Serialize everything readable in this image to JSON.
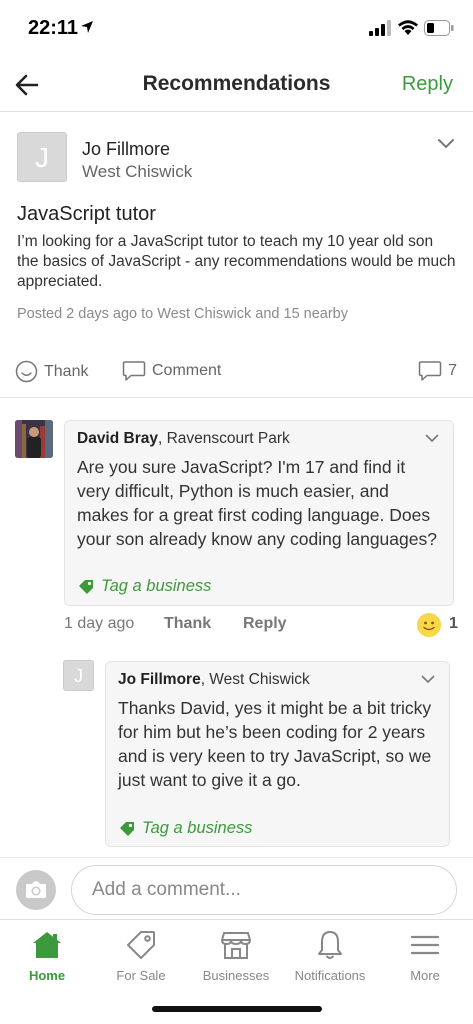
{
  "status": {
    "time": "22:11"
  },
  "nav": {
    "title": "Recommendations",
    "reply_label": "Reply"
  },
  "post": {
    "avatar_letter": "J",
    "author": "Jo Fillmore",
    "area": "West Chiswick",
    "title": "JavaScript tutor",
    "body": "I’m looking for a JavaScript tutor to teach my 10 year old son the basics of JavaScript - any recommendations would be much appreciated.",
    "meta": "Posted 2 days ago to West Chiswick and 15 nearby"
  },
  "actions": {
    "thank": "Thank",
    "comment": "Comment",
    "comment_count": "7"
  },
  "comments": [
    {
      "author": "David Bray",
      "area": ", Ravenscourt Park",
      "text": "Are you sure JavaScript? I'm 17 and find it very difficult, Python is much easier, and makes for a great first coding language. Does your son already know any coding languages?",
      "tag_label": "Tag a business",
      "time": "1 day ago",
      "thank": "Thank",
      "reply": "Reply",
      "reaction_count": "1"
    },
    {
      "avatar_letter": "J",
      "author": "Jo Fillmore",
      "area": ", West Chiswick",
      "text": "Thanks David, yes it might be a bit tricky for him but he’s been coding for 2 years and is very keen to try JavaScript, so we just want to give it a go.",
      "tag_label": "Tag a business"
    }
  ],
  "composer": {
    "placeholder": "Add a comment..."
  },
  "tabs": [
    {
      "label": "Home",
      "icon": "home-icon",
      "active": true
    },
    {
      "label": "For Sale",
      "icon": "tag-icon"
    },
    {
      "label": "Businesses",
      "icon": "store-icon"
    },
    {
      "label": "Notifications",
      "icon": "bell-icon"
    },
    {
      "label": "More",
      "icon": "menu-icon"
    }
  ],
  "colors": {
    "accent": "#3c9a3c",
    "text": "#222222",
    "muted": "#888888",
    "bubble": "#f6f6f6"
  }
}
